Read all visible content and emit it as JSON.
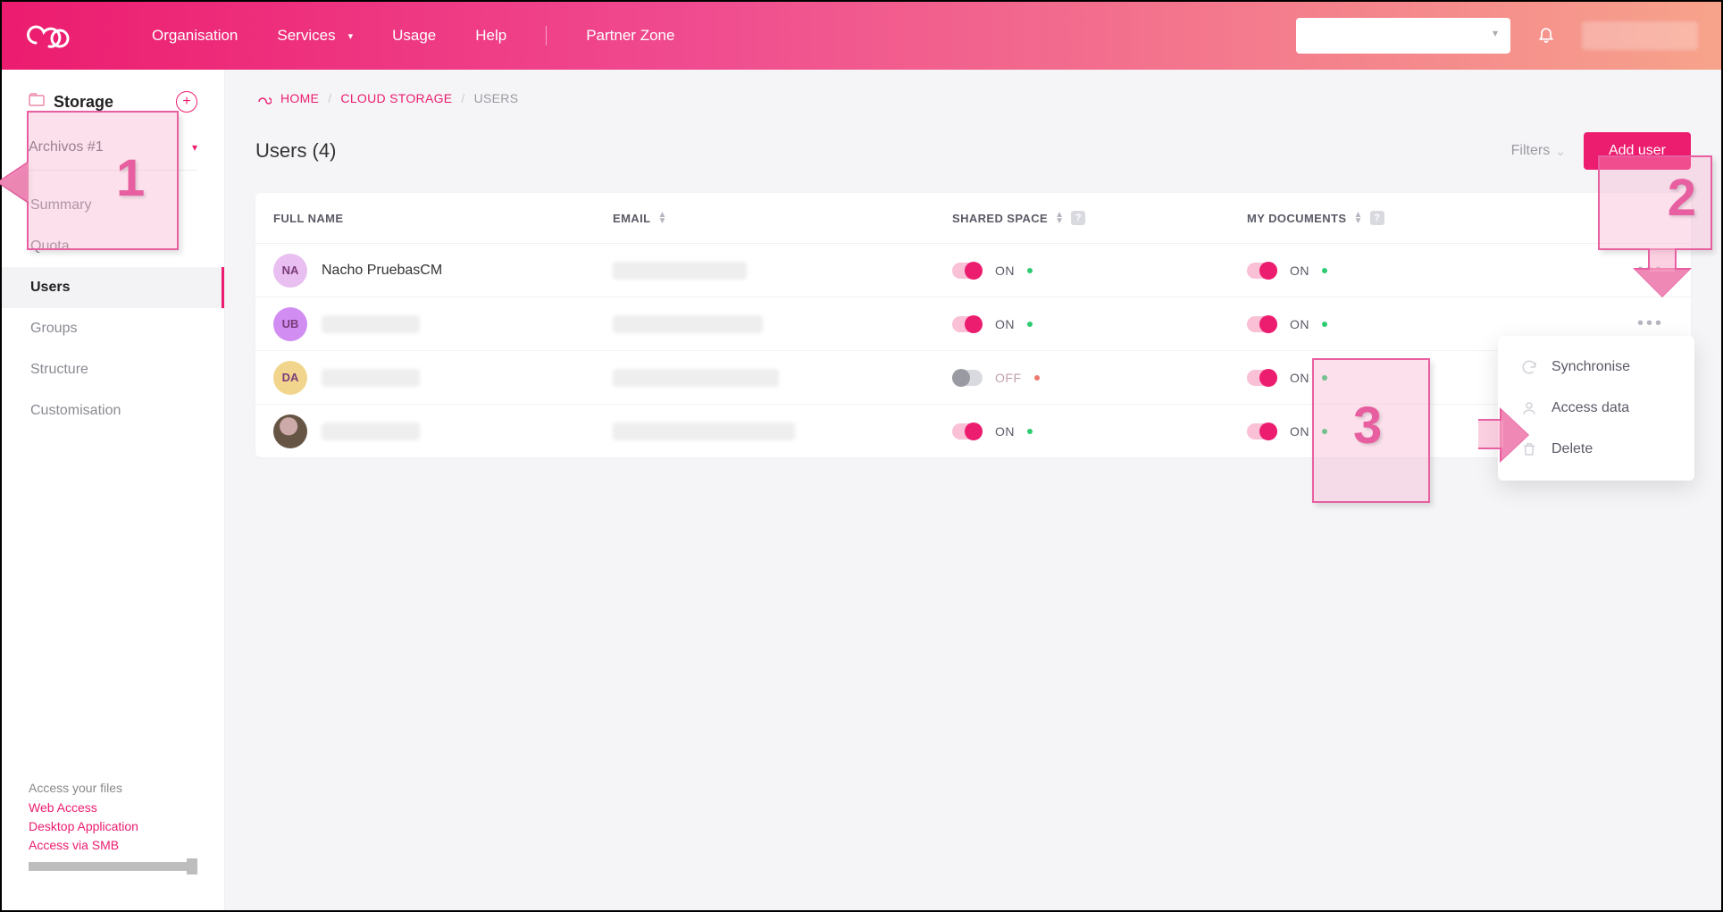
{
  "topnav": {
    "items": [
      "Organisation",
      "Services",
      "Usage",
      "Help",
      "Partner Zone"
    ],
    "services_has_caret": true
  },
  "sidebar": {
    "title": "Storage",
    "dropdown": "Archivos #1",
    "menu": [
      "Summary",
      "Quota",
      "Users",
      "Groups",
      "Structure",
      "Customisation"
    ],
    "active_index": 2,
    "footer_header": "Access your files",
    "footer_links": [
      "Web Access",
      "Desktop Application",
      "Access via SMB"
    ]
  },
  "breadcrumb": {
    "home": "HOME",
    "mid": "CLOUD STORAGE",
    "leaf": "USERS"
  },
  "page": {
    "title": "Users (4)",
    "filters": "Filters",
    "add_button": "Add user"
  },
  "columns": {
    "name": "FULL NAME",
    "email": "EMAIL",
    "shared": "SHARED SPACE",
    "mydocs": "MY DOCUMENTS"
  },
  "rows": [
    {
      "initials": "NA",
      "avatar_bg": "#e8bff0",
      "name": "Nacho PruebasCM",
      "shared": "ON",
      "mydocs": "ON",
      "photo": false
    },
    {
      "initials": "UB",
      "avatar_bg": "#d18df2",
      "name": "",
      "shared": "ON",
      "mydocs": "ON",
      "photo": false
    },
    {
      "initials": "DA",
      "avatar_bg": "#f2d58d",
      "name": "",
      "shared": "OFF",
      "mydocs": "ON",
      "photo": false
    },
    {
      "initials": "",
      "avatar_bg": "#333",
      "name": "",
      "shared": "ON",
      "mydocs": "ON",
      "photo": true
    }
  ],
  "context_menu": {
    "items": [
      "Synchronise",
      "Access data",
      "Delete"
    ]
  },
  "callouts": {
    "c1": "1",
    "c2": "2",
    "c3": "3"
  },
  "colors": {
    "accent": "#ec1c6f"
  }
}
